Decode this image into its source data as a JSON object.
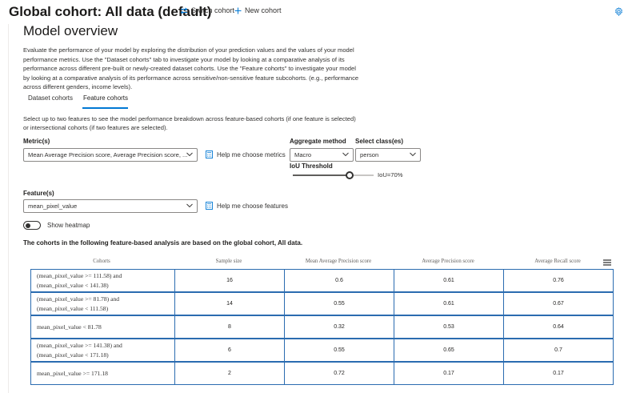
{
  "header": {
    "cohort_title": "Global cohort: All data (default)",
    "switch_cohort": "Switch cohort",
    "new_cohort": "New cohort"
  },
  "overview": {
    "title": "Model overview",
    "description": "Evaluate the performance of your model by exploring the distribution of your prediction values and the values of your model performance metrics. Use the \"Dataset cohorts\" tab to investigate your model by looking at a comparative analysis of its performance across different pre-built or newly-created dataset cohorts. Use the \"Feature cohorts\" to investigate your model by looking at a comparative analysis of its performance across sensitive/non-sensitive feature subcohorts. (e.g., performance across different genders, income levels).",
    "tabs": [
      {
        "label": "Dataset cohorts",
        "active": false
      },
      {
        "label": "Feature cohorts",
        "active": true
      }
    ],
    "instruction": "Select up to two features to see the model performance breakdown across feature-based cohorts (if one feature is selected) or intersectional cohorts (if two features are selected)."
  },
  "controls": {
    "metric_label": "Metric(s)",
    "metric_value": "Mean Average Precision score, Average Precision score, ...",
    "help_metrics": "Help me choose metrics",
    "aggregate_label": "Aggregate method",
    "aggregate_value": "Macro",
    "class_label": "Select class(es)",
    "class_value": "person",
    "iou_label": "IoU Threshold",
    "iou_value": 0.7,
    "iou_text": "IoU=70%",
    "feature_label": "Feature(s)",
    "feature_value": "mean_pixel_value",
    "help_features": "Help me choose features",
    "heatmap_label": "Show heatmap",
    "heatmap_on": false
  },
  "analysis": {
    "note": "The cohorts in the following feature-based analysis are based on the global cohort, All data.",
    "columns": [
      "Cohorts",
      "Sample size",
      "Mean Average Precision score",
      "Average Precision score",
      "Average Recall score"
    ],
    "rows": [
      {
        "cohort": [
          "(mean_pixel_value >= 111.58) and",
          "(mean_pixel_value < 141.38)"
        ],
        "sample_size": "16",
        "map": "0.6",
        "ap": "0.61",
        "ar": "0.76"
      },
      {
        "cohort": [
          "(mean_pixel_value >= 81.78) and",
          "(mean_pixel_value < 111.58)"
        ],
        "sample_size": "14",
        "map": "0.55",
        "ap": "0.61",
        "ar": "0.67"
      },
      {
        "cohort": [
          "mean_pixel_value < 81.78"
        ],
        "sample_size": "8",
        "map": "0.32",
        "ap": "0.53",
        "ar": "0.64"
      },
      {
        "cohort": [
          "(mean_pixel_value >= 141.38) and",
          "(mean_pixel_value < 171.18)"
        ],
        "sample_size": "6",
        "map": "0.55",
        "ap": "0.65",
        "ar": "0.7"
      },
      {
        "cohort": [
          "mean_pixel_value >= 171.18"
        ],
        "sample_size": "2",
        "map": "0.72",
        "ap": "0.17",
        "ar": "0.17"
      }
    ]
  },
  "colors": {
    "accent": "#0078d4",
    "cell_border": "#2b6cb0"
  }
}
